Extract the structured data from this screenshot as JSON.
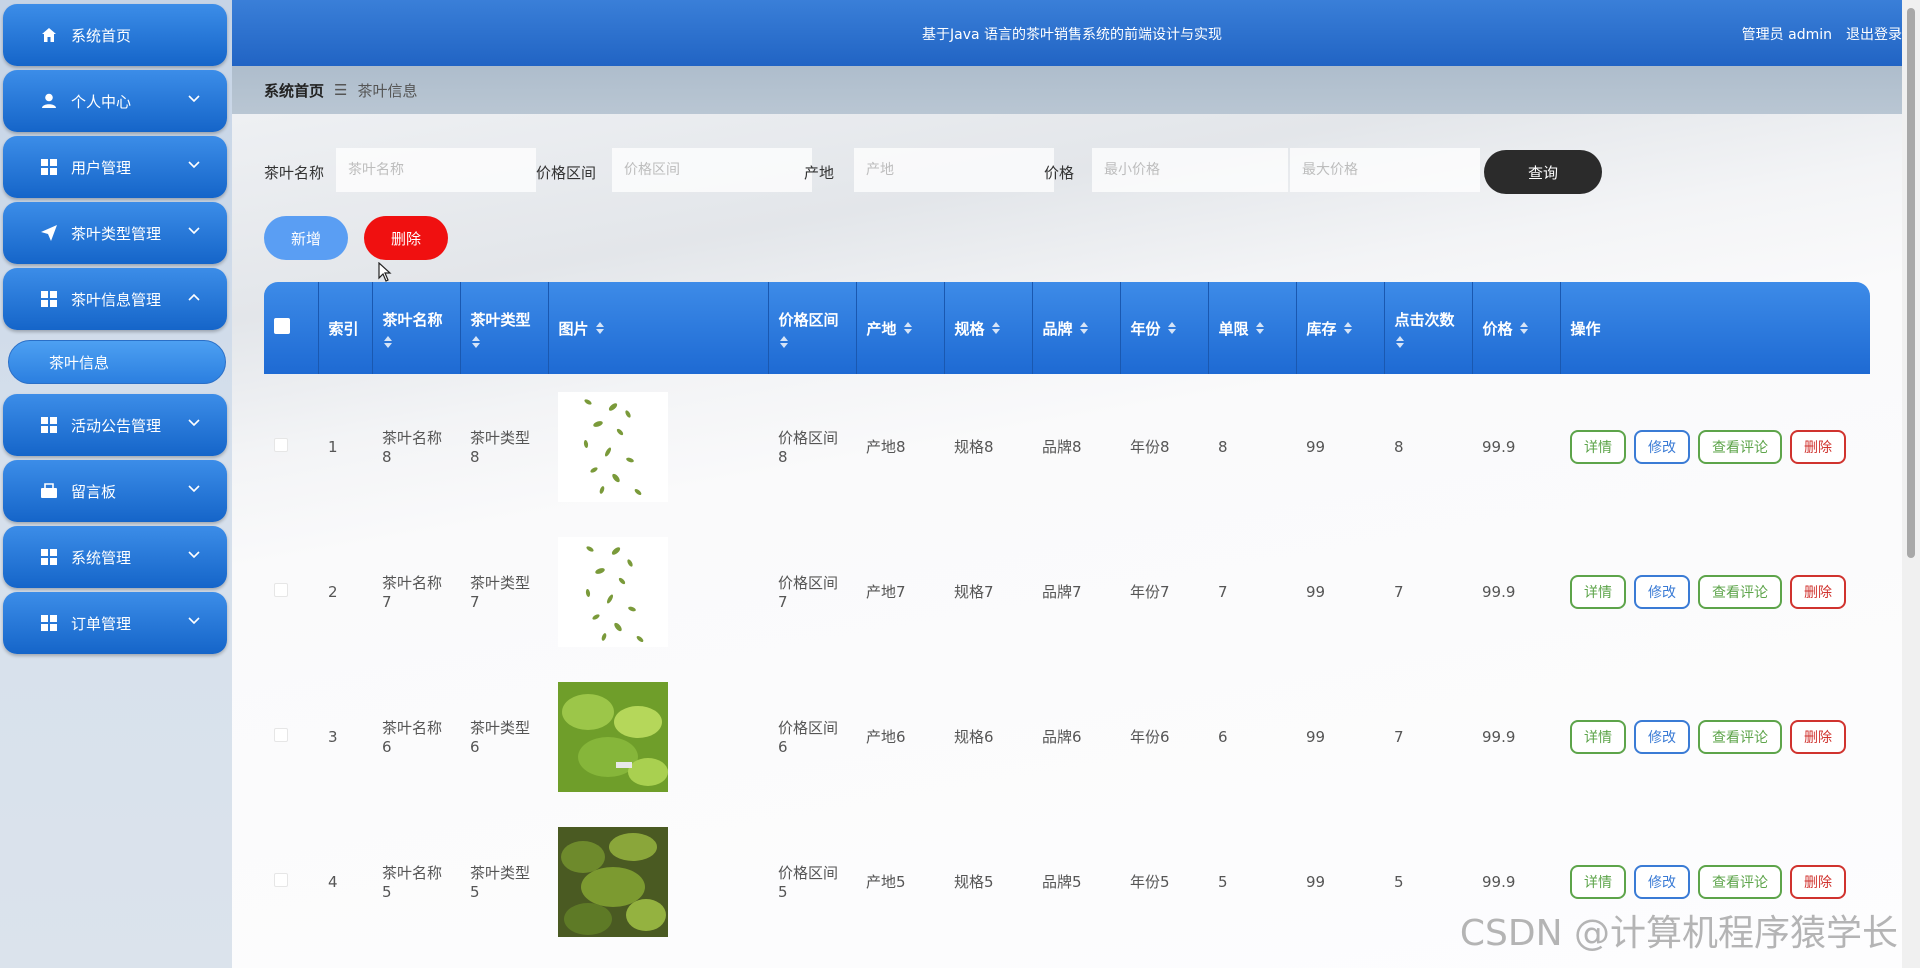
{
  "header": {
    "title": "基于Java 语言的茶叶销售系统的前端设计与实现",
    "user": "管理员 admin",
    "logout": "退出登录"
  },
  "sidebar": {
    "items": [
      {
        "label": "系统首页",
        "icon": "home-icon",
        "arrow": ""
      },
      {
        "label": "个人中心",
        "icon": "user-icon",
        "arrow": "chevron-down"
      },
      {
        "label": "用户管理",
        "icon": "grid-icon",
        "arrow": "chevron-down"
      },
      {
        "label": "茶叶类型管理",
        "icon": "paper-plane-icon",
        "arrow": "chevron-down"
      },
      {
        "label": "茶叶信息管理",
        "icon": "grid-icon",
        "arrow": "chevron-up"
      },
      {
        "label": "活动公告管理",
        "icon": "grid-icon",
        "arrow": "chevron-down"
      },
      {
        "label": "留言板",
        "icon": "message-icon",
        "arrow": "chevron-down"
      },
      {
        "label": "系统管理",
        "icon": "grid-icon",
        "arrow": "chevron-down"
      },
      {
        "label": "订单管理",
        "icon": "grid-icon",
        "arrow": "chevron-down"
      }
    ],
    "sub_item": "茶叶信息"
  },
  "breadcrumb": {
    "home": "系统首页",
    "separator": "☰",
    "current": "茶叶信息"
  },
  "search": {
    "name_label": "茶叶名称",
    "name_placeholder": "茶叶名称",
    "range_label": "价格区间",
    "range_placeholder": "价格区间",
    "origin_label": "产地",
    "origin_placeholder": "产地",
    "price_label": "价格",
    "min_placeholder": "最小价格",
    "max_placeholder": "最大价格",
    "query_button": "查询"
  },
  "actions": {
    "add": "新增",
    "delete": "删除"
  },
  "table": {
    "columns": [
      "索引",
      "茶叶名称",
      "茶叶类型",
      "图片",
      "价格区间",
      "产地",
      "规格",
      "品牌",
      "年份",
      "单限",
      "库存",
      "点击次数",
      "价格",
      "操作"
    ],
    "rows": [
      {
        "index": "1",
        "name": "茶叶名称8",
        "type": "茶叶类型8",
        "range": "价格区间8",
        "origin": "产地8",
        "spec": "规格8",
        "brand": "品牌8",
        "year": "年份8",
        "limit": "8",
        "stock": "99",
        "clicks": "8",
        "price": "99.9"
      },
      {
        "index": "2",
        "name": "茶叶名称7",
        "type": "茶叶类型7",
        "range": "价格区间7",
        "origin": "产地7",
        "spec": "规格7",
        "brand": "品牌7",
        "year": "年份7",
        "limit": "7",
        "stock": "99",
        "clicks": "7",
        "price": "99.9"
      },
      {
        "index": "3",
        "name": "茶叶名称6",
        "type": "茶叶类型6",
        "range": "价格区间6",
        "origin": "产地6",
        "spec": "规格6",
        "brand": "品牌6",
        "year": "年份6",
        "limit": "6",
        "stock": "99",
        "clicks": "7",
        "price": "99.9"
      },
      {
        "index": "4",
        "name": "茶叶名称5",
        "type": "茶叶类型5",
        "range": "价格区间5",
        "origin": "产地5",
        "spec": "规格5",
        "brand": "品牌5",
        "year": "年份5",
        "limit": "5",
        "stock": "99",
        "clicks": "5",
        "price": "99.9"
      }
    ],
    "ops": {
      "detail": "详情",
      "edit": "修改",
      "review": "查看评论",
      "delete": "删除"
    }
  },
  "watermark": "CSDN @计算机程序猿学长",
  "colors": {
    "primary": "#2b7fe0",
    "header": "#2164c4",
    "danger": "#f01010",
    "success": "#5da44a"
  }
}
